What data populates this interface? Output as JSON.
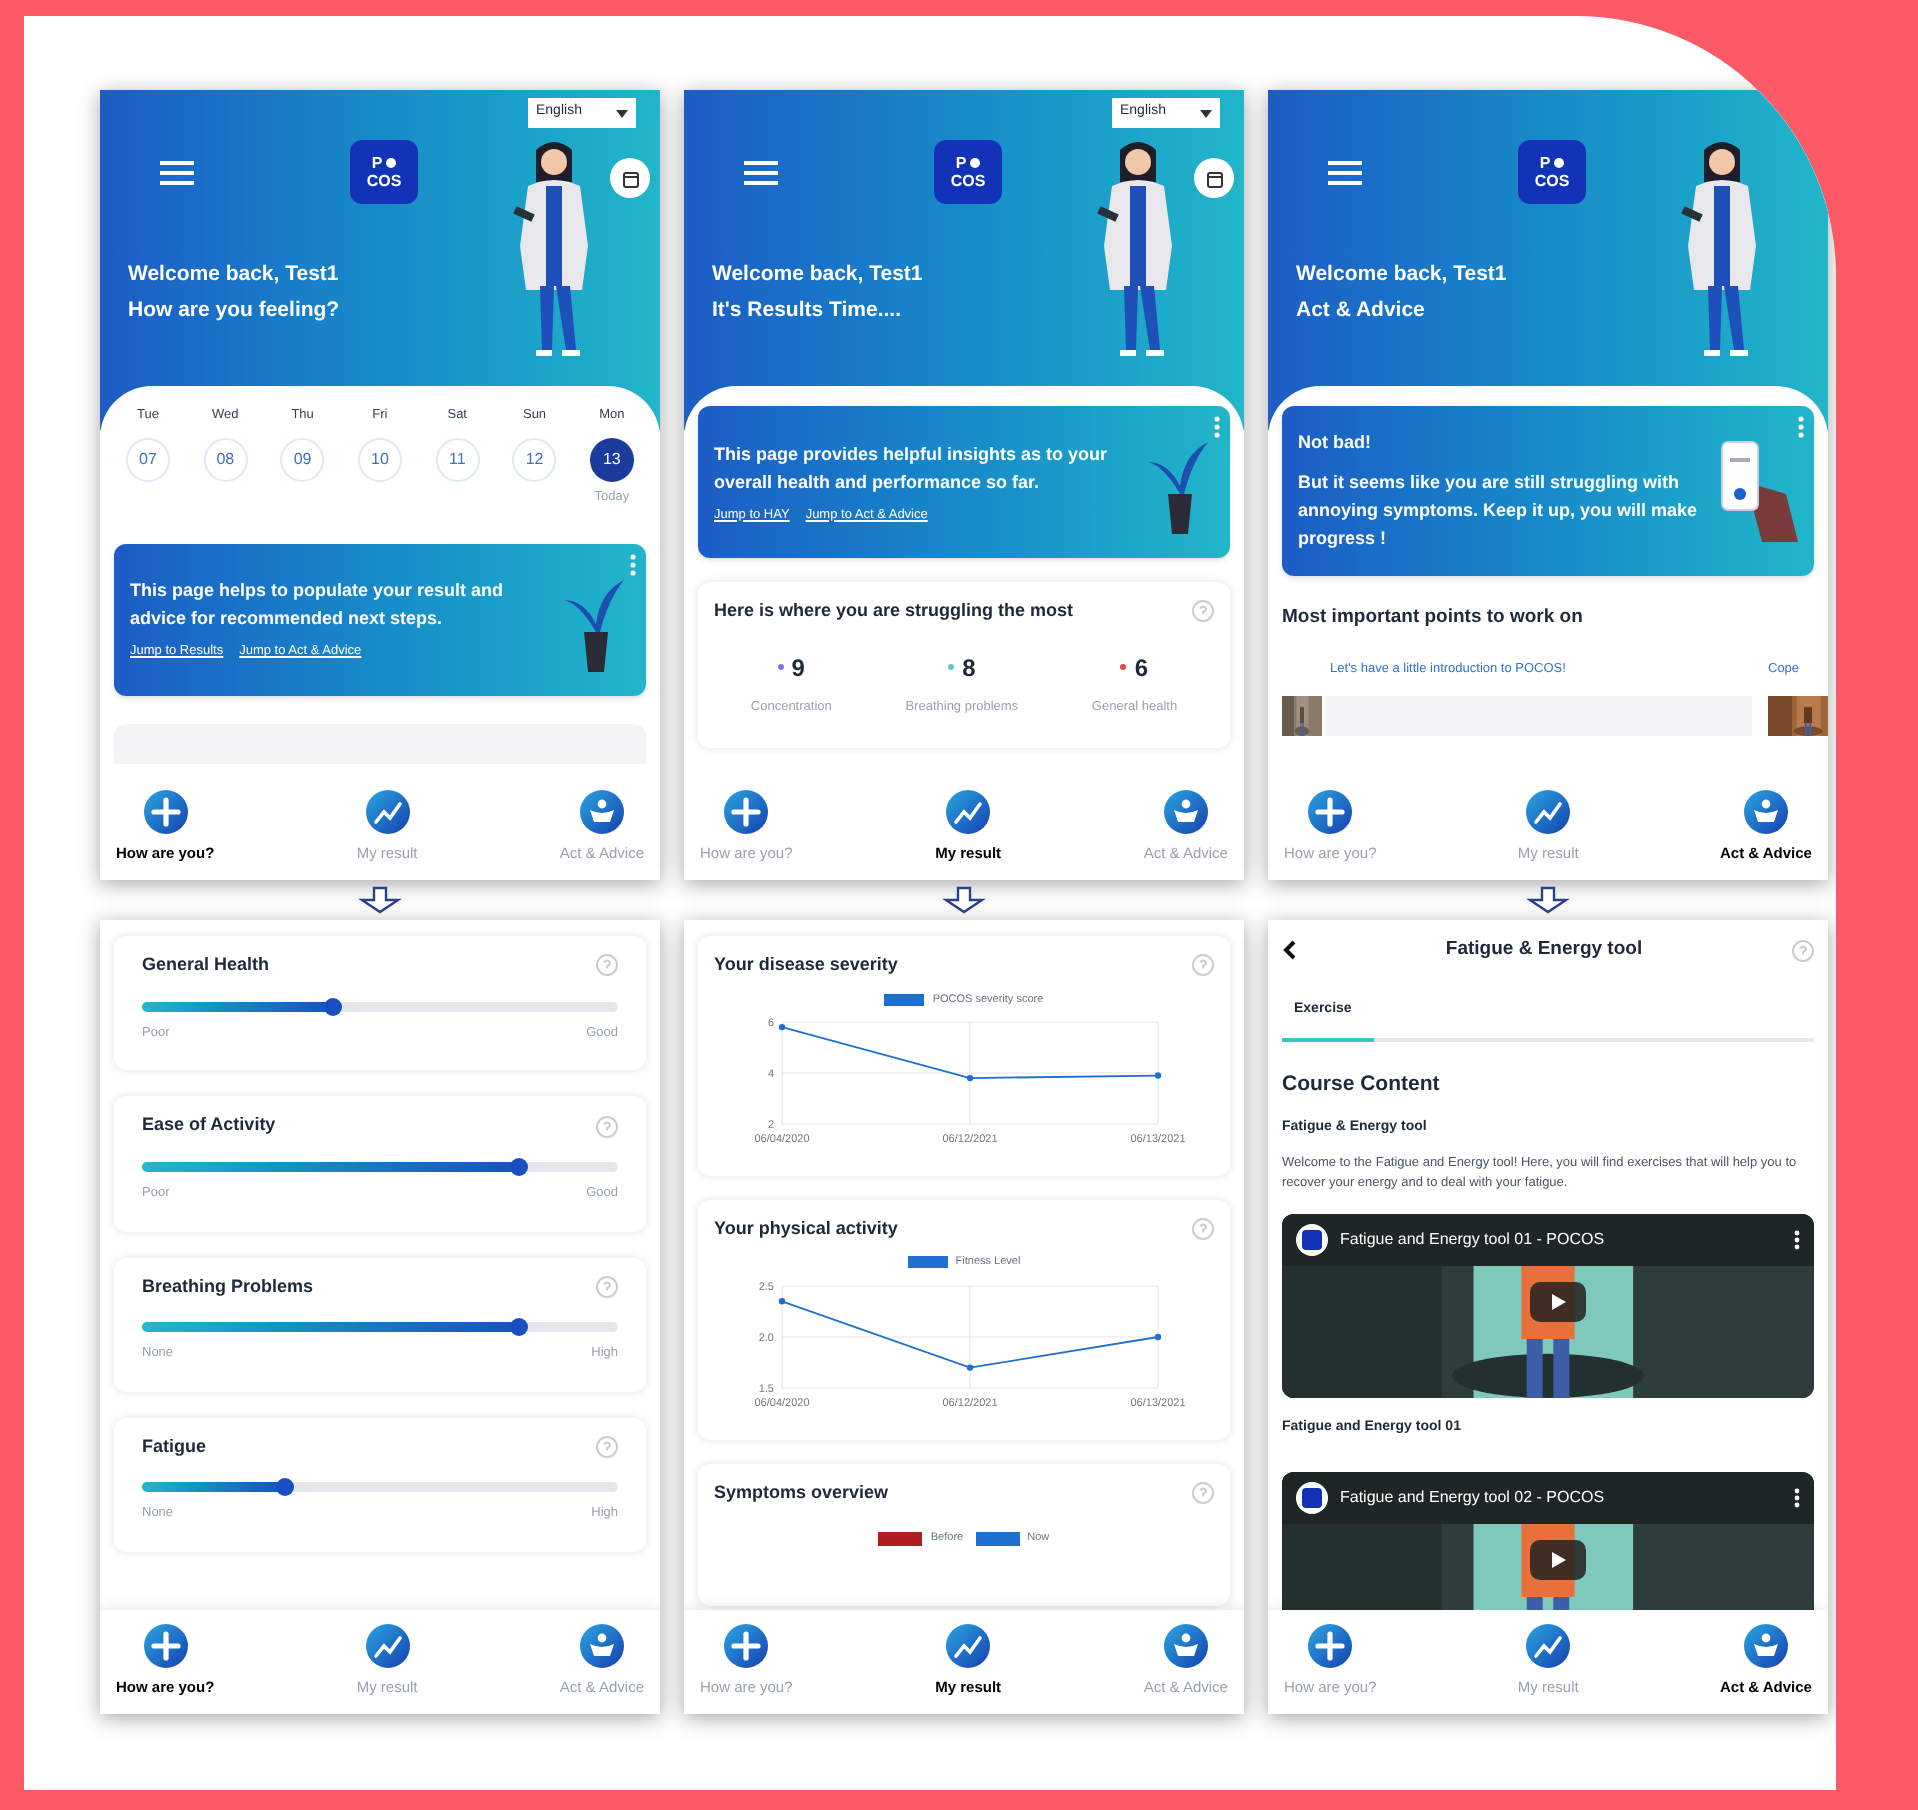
{
  "columns": [
    {
      "top": {
        "kind": "home",
        "language": "English",
        "logo": [
          "P",
          "COS"
        ],
        "calendar_button": true,
        "greeting": "Welcome back, Test1",
        "subtitle": "How are you feeling?",
        "days": [
          {
            "day": "Tue",
            "date": "07",
            "selected": false
          },
          {
            "day": "Wed",
            "date": "08",
            "selected": false
          },
          {
            "day": "Thu",
            "date": "09",
            "selected": false
          },
          {
            "day": "Fri",
            "date": "10",
            "selected": false
          },
          {
            "day": "Sat",
            "date": "11",
            "selected": false
          },
          {
            "day": "Sun",
            "date": "12",
            "selected": false
          },
          {
            "day": "Mon",
            "date": "13",
            "selected": true
          }
        ],
        "today_label": "Today",
        "info_card": {
          "kind": "plant",
          "text": "This page helps to populate your result and advice for recommended next steps.",
          "links": [
            "Jump to Results",
            "Jump to Act & Advice"
          ]
        },
        "nav": [
          {
            "label": "How are you?",
            "selected": true
          },
          {
            "label": "My result",
            "selected": false
          },
          {
            "label": "Act & Advice",
            "selected": false
          }
        ]
      },
      "bottom": {
        "kind": "sliders",
        "sliders": [
          {
            "title": "General Health",
            "level": 0.4,
            "min_label": "Poor",
            "max_label": "Good"
          },
          {
            "title": "Ease of Activity",
            "level": 0.79,
            "min_label": "Poor",
            "max_label": "Good"
          },
          {
            "title": "Breathing Problems",
            "level": 0.79,
            "min_label": "None",
            "max_label": "High"
          },
          {
            "title": "Fatigue",
            "level": 0.3,
            "min_label": "None",
            "max_label": "High"
          }
        ],
        "nav": [
          {
            "label": "How are you?",
            "selected": true
          },
          {
            "label": "My result",
            "selected": false
          },
          {
            "label": "Act & Advice",
            "selected": false
          }
        ]
      }
    },
    {
      "top": {
        "kind": "results",
        "language": "English",
        "logo": [
          "P",
          "COS"
        ],
        "calendar_button": true,
        "greeting": "Welcome back, Test1",
        "subtitle": "It's Results Time....",
        "info_card": {
          "kind": "plant",
          "text": "This page provides helpful insights as to your overall health and performance so far.",
          "links": [
            "Jump to HAY",
            "Jump to Act & Advice"
          ]
        },
        "struggle_card": {
          "title": "Here is where you are struggling the most",
          "items": [
            {
              "value": "9",
              "label": "Concentration",
              "color": "#8b6fd8"
            },
            {
              "value": "8",
              "label": "Breathing problems",
              "color": "#5fc7c0"
            },
            {
              "value": "6",
              "label": "General health",
              "color": "#e04a3c"
            }
          ]
        },
        "nav": [
          {
            "label": "How are you?",
            "selected": false
          },
          {
            "label": "My result",
            "selected": true
          },
          {
            "label": "Act & Advice",
            "selected": false
          }
        ]
      },
      "bottom": {
        "kind": "charts",
        "cards": [
          {
            "kind": "line",
            "title": "Your disease severity",
            "chart_data": {
              "type": "line",
              "categories": [
                "06/04/2020",
                "06/12/2021",
                "06/13/2021"
              ],
              "series": [
                {
                  "name": "POCOS severity score",
                  "color": "#1f6fd0",
                  "marker": "circle",
                  "values": [
                    5.8,
                    3.8,
                    3.9
                  ]
                }
              ],
              "ylim": [
                2,
                6
              ],
              "yticks": [
                2,
                4,
                6
              ]
            }
          },
          {
            "kind": "line",
            "title": "Your physical activity",
            "chart_data": {
              "type": "line",
              "categories": [
                "06/04/2020",
                "06/12/2021",
                "06/13/2021"
              ],
              "series": [
                {
                  "name": "Fitness Level",
                  "color": "#1f6fd0",
                  "marker": "circle",
                  "values": [
                    2.35,
                    1.7,
                    2.0
                  ]
                }
              ],
              "ylim": [
                1.5,
                2.5
              ],
              "yticks": [
                {
                  "value": 1.5,
                  "label": "1.5"
                },
                {
                  "value": 2,
                  "label": "2.0"
                },
                {
                  "value": 2.5,
                  "label": "2.5"
                }
              ]
            }
          },
          {
            "kind": "legend",
            "title": "Symptoms overview",
            "legend": [
              {
                "name": "Before",
                "color": "#b01c22"
              },
              {
                "name": "Now",
                "color": "#1f6fd0"
              }
            ]
          }
        ],
        "nav": [
          {
            "label": "How are you?",
            "selected": false
          },
          {
            "label": "My result",
            "selected": true
          },
          {
            "label": "Act & Advice",
            "selected": false
          }
        ]
      }
    },
    {
      "top": {
        "kind": "advice",
        "logo": [
          "P",
          "COS"
        ],
        "greeting": "Welcome back, Test1",
        "subtitle": "Act & Advice",
        "info_card": {
          "kind": "phone",
          "title": "Not bad!",
          "text": "But it seems like you are still struggling with annoying symptoms. Keep it up, you will make progress !"
        },
        "section_title": "Most important points to work on",
        "carousel": [
          {
            "title": "Let's have a little introduction to POCOS!"
          },
          {
            "title": "Cope"
          }
        ],
        "nav": [
          {
            "label": "How are you?",
            "selected": false
          },
          {
            "label": "My result",
            "selected": false
          },
          {
            "label": "Act & Advice",
            "selected": true
          }
        ]
      },
      "bottom": {
        "kind": "course",
        "title": "Fatigue & Energy tool",
        "tabs": [
          {
            "label": "Exercise",
            "selected": true
          }
        ],
        "heading": "Course Content",
        "subheading": "Fatigue & Energy tool",
        "description": "Welcome to the Fatigue and Energy tool! Here, you will find exercises that will help you to recover your energy and to deal with your fatigue.",
        "videos": [
          {
            "title": "Fatigue and Energy tool 01 - POCOS",
            "caption": "Fatigue and Energy tool 01"
          },
          {
            "title": "Fatigue and Energy tool 02 - POCOS"
          }
        ],
        "nav": [
          {
            "label": "How are you?",
            "selected": false
          },
          {
            "label": "My result",
            "selected": false
          },
          {
            "label": "Act & Advice",
            "selected": true
          }
        ]
      }
    }
  ]
}
